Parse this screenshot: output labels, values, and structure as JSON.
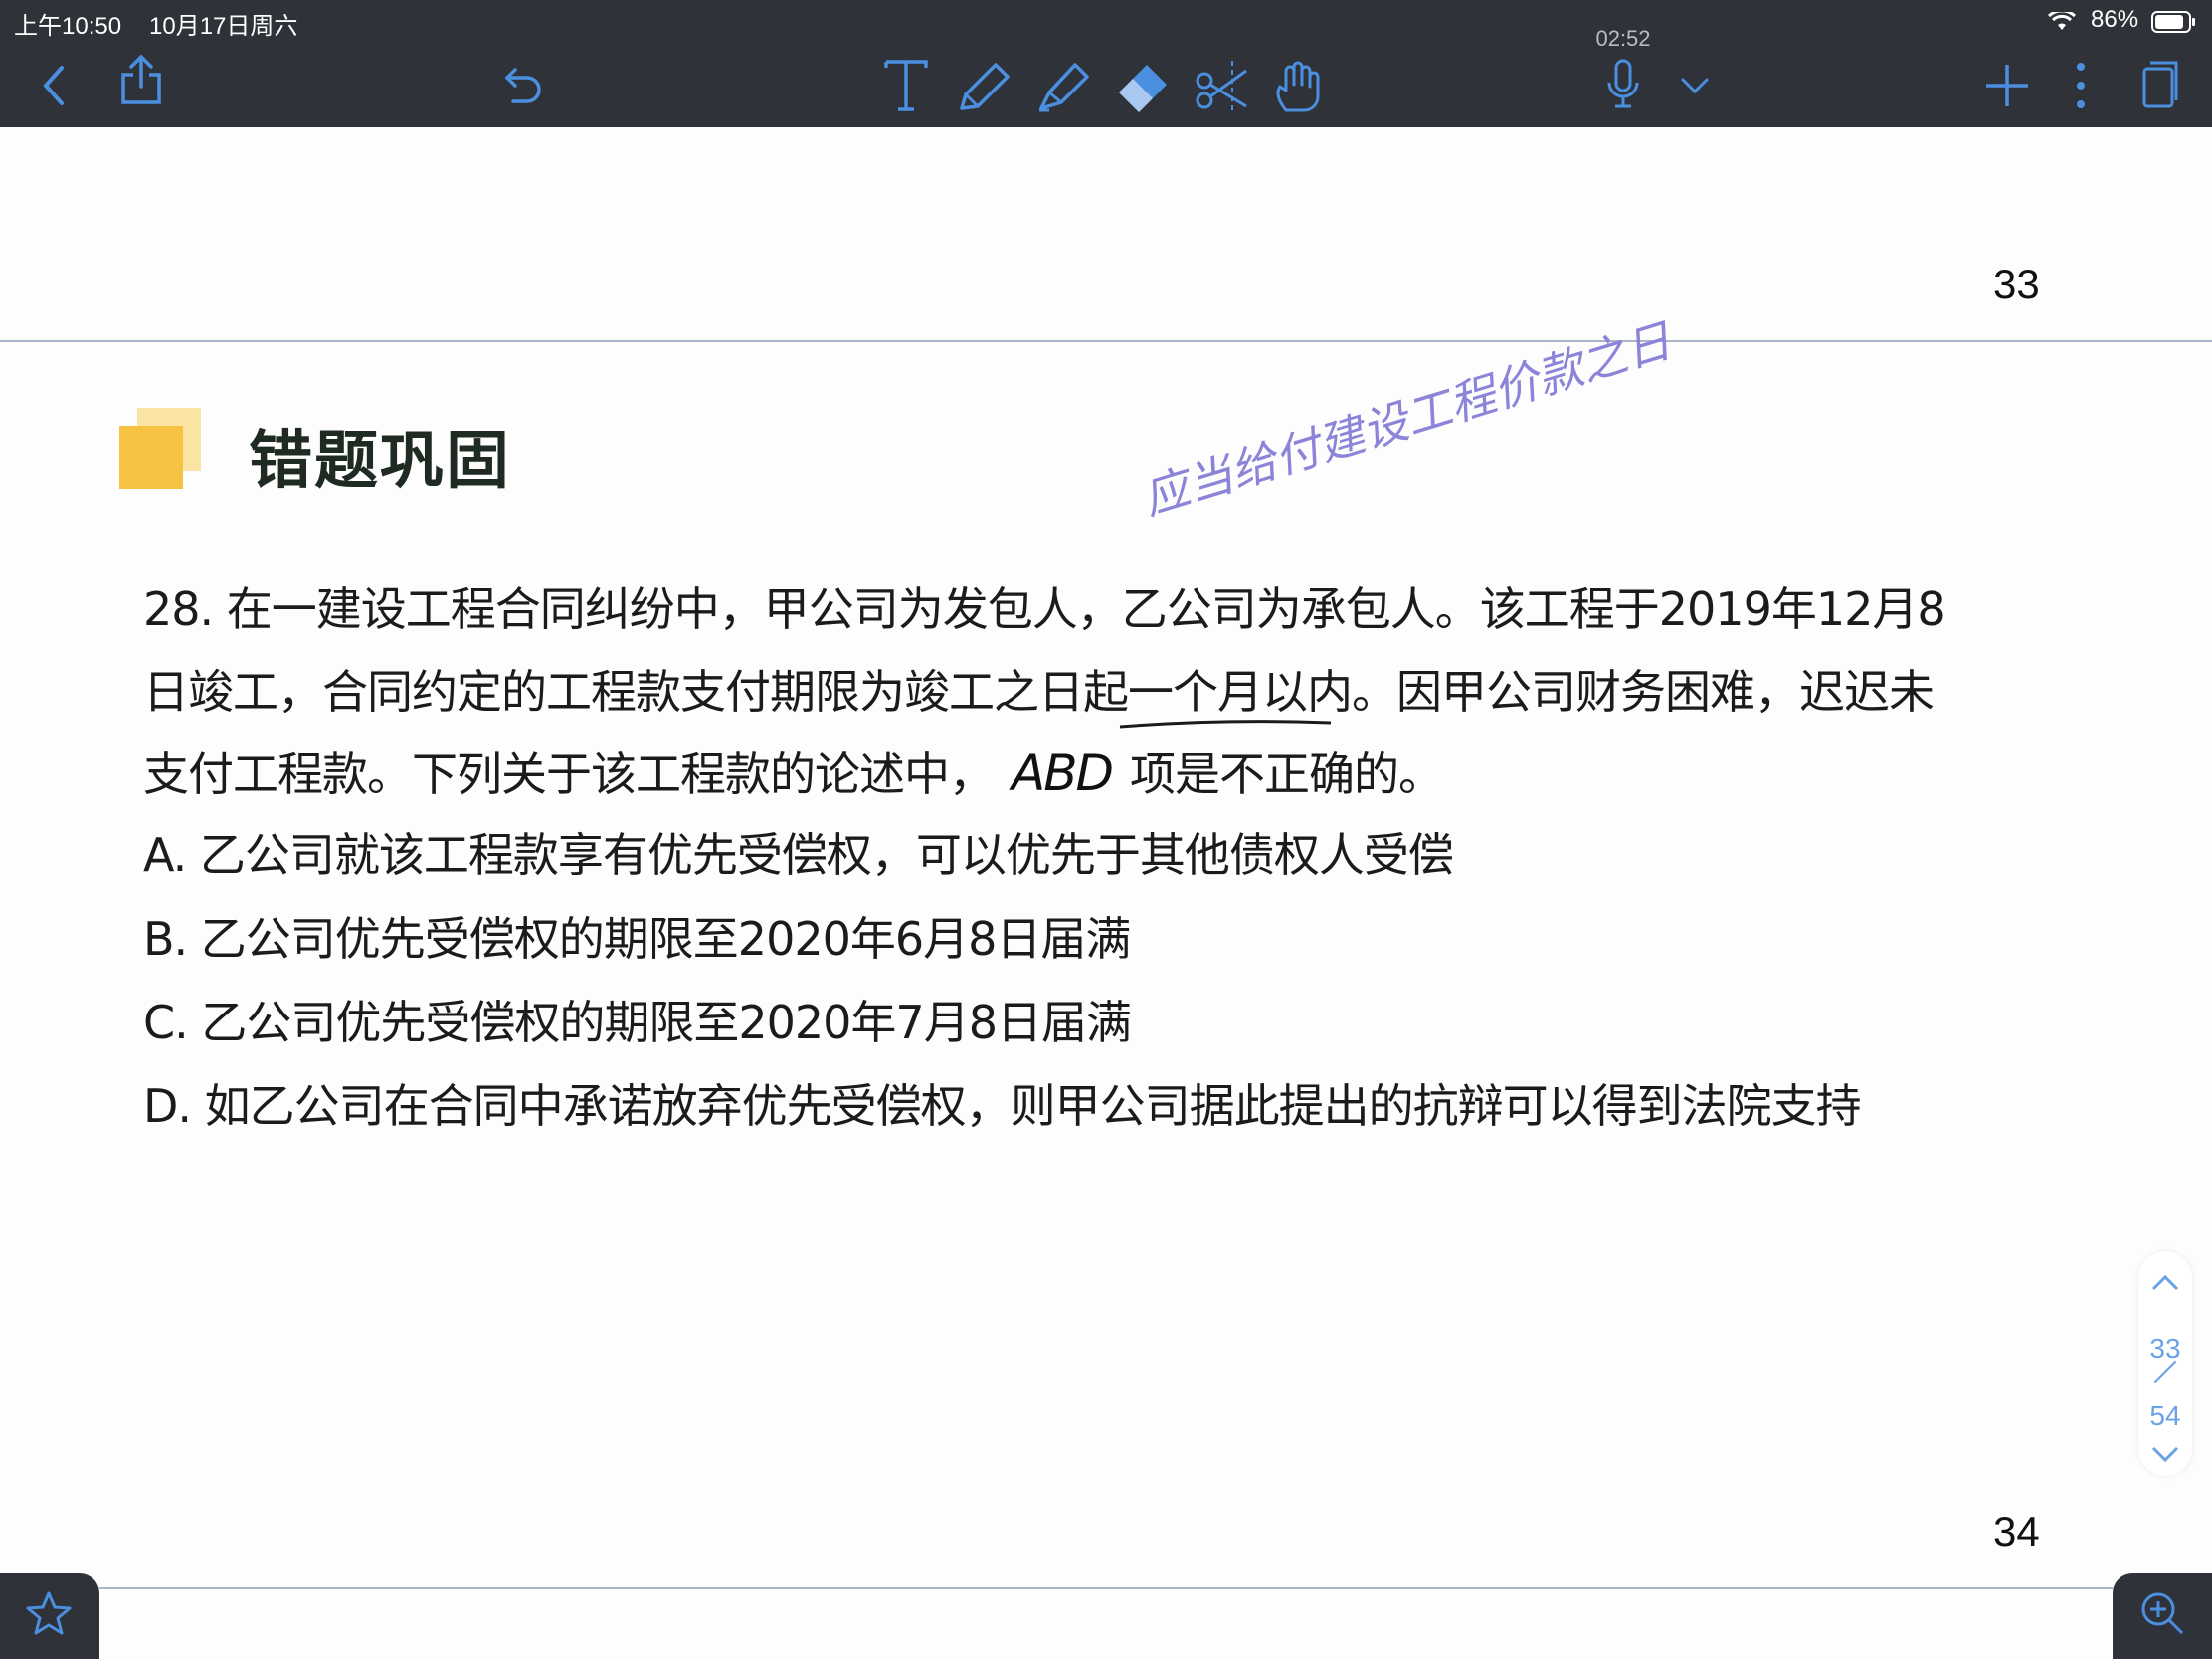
{
  "status_bar": {
    "time": "上午10:50",
    "date": "10月17日周六",
    "battery": "86%"
  },
  "toolbar": {
    "recording_time": "02:52",
    "icons": [
      "back-icon",
      "share-icon",
      "undo-icon",
      "text-tool-icon",
      "pen-icon",
      "highlighter-icon",
      "eraser-icon",
      "lasso-icon",
      "hand-icon",
      "microphone-icon",
      "chevron-down-icon",
      "add-icon",
      "more-icon",
      "pages-icon"
    ]
  },
  "document": {
    "page_top_number": "33",
    "page_bottom_number": "34",
    "heading": "错题巩固",
    "question": {
      "line1": "28. 在一建设工程合同纠纷中，甲公司为发包人，乙公司为承包人。该工程于2019年12月8",
      "line2_a": "日竣工，合同约定的工程款支付期限为竣工之日起",
      "line2_b": "一个月以",
      "line2_c": "内。因甲公司财务困难，迟迟未",
      "line3_a": "支付工程款。下列关于该工程款的论述中，",
      "line3_answer": "ABD",
      "line3_b": "项是不正确的。"
    },
    "options": [
      "A. 乙公司就该工程款享有优先受偿权，可以优先于其他债权人受偿",
      "B. 乙公司优先受偿权的期限至2020年6月8日届满",
      "C. 乙公司优先受偿权的期限至2020年7月8日届满",
      "D. 如乙公司在合同中承诺放弃优先受偿权，则甲公司据此提出的抗辩可以得到法院支持"
    ],
    "handwritten_note": "应当给付建设工程价款之日"
  },
  "pager": {
    "current": "33",
    "total": "54"
  },
  "colors": {
    "toolbar_bg": "#2f3238",
    "accent": "#6aa2e6",
    "heading_square": "#f5c242",
    "handwriting": "#8c84d8"
  }
}
